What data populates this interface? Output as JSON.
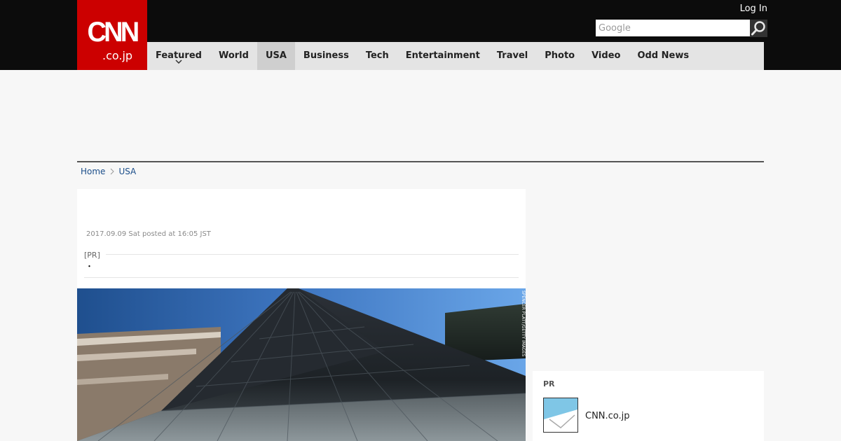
{
  "header": {
    "logo_main": "CNN",
    "logo_sub": ".co.jp",
    "login_label": "Log In",
    "search_placeholder": "Google",
    "search_icon": "search-icon"
  },
  "nav": {
    "items": [
      {
        "label": "Featured",
        "has_dropdown": true
      },
      {
        "label": "World"
      },
      {
        "label": "USA",
        "active": true
      },
      {
        "label": "Business"
      },
      {
        "label": "Tech"
      },
      {
        "label": "Entertainment"
      },
      {
        "label": "Travel"
      },
      {
        "label": "Photo"
      },
      {
        "label": "Video"
      },
      {
        "label": "Odd News"
      }
    ]
  },
  "breadcrumb": {
    "home": "Home",
    "current": "USA"
  },
  "article": {
    "posted": "2017.09.09 Sat posted at 16:05 JST",
    "pr_label": "[PR]",
    "pr_text": "・",
    "photo_credit": "SPENCER PLATT/GETTY IMAGES"
  },
  "sidebar": {
    "pr_title": "PR",
    "pr_link": "CNN.co.jp"
  },
  "colors": {
    "brand_red": "#cc0000",
    "topbar": "#0c0c0c",
    "nav_bg": "#e4e4e4",
    "link_blue": "#1b4e8a"
  }
}
